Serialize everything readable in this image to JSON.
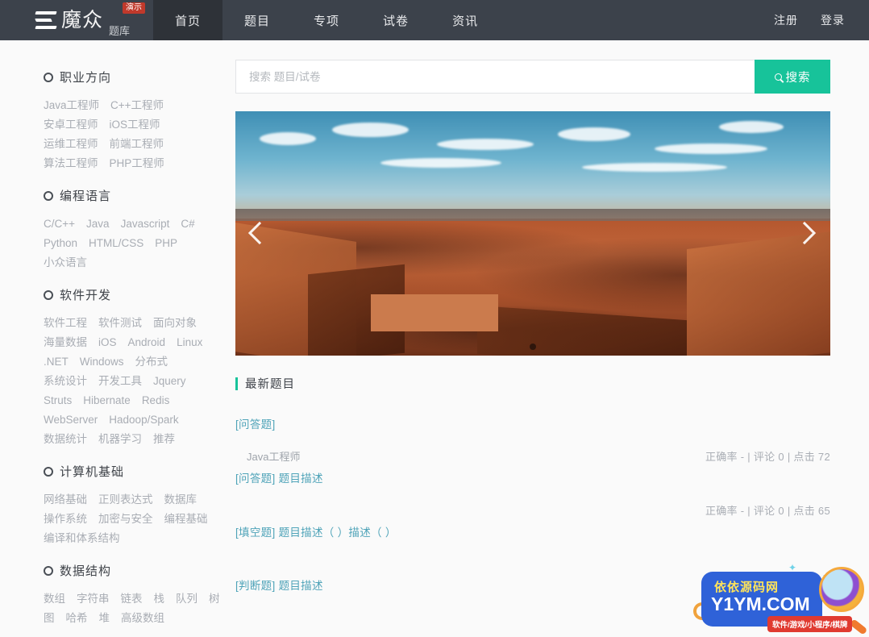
{
  "header": {
    "brand_name": "魔众",
    "brand_sub": "题库",
    "brand_badge": "演示",
    "nav": [
      {
        "label": "首页",
        "active": true
      },
      {
        "label": "题目",
        "active": false
      },
      {
        "label": "专项",
        "active": false
      },
      {
        "label": "试卷",
        "active": false
      },
      {
        "label": "资讯",
        "active": false
      }
    ],
    "register": "注册",
    "login": "登录"
  },
  "search": {
    "placeholder": "搜索 题目/试卷",
    "value": "",
    "button_label": "搜索",
    "button_color": "#17c39a"
  },
  "sidebar": {
    "categories": [
      {
        "title": "职业方向",
        "tags": [
          "Java工程师",
          "C++工程师",
          "安卓工程师",
          "iOS工程师",
          "运维工程师",
          "前端工程师",
          "算法工程师",
          "PHP工程师"
        ]
      },
      {
        "title": "编程语言",
        "tags": [
          "C/C++",
          "Java",
          "Javascript",
          "C#",
          "Python",
          "HTML/CSS",
          "PHP",
          "小众语言"
        ]
      },
      {
        "title": "软件开发",
        "tags": [
          "软件工程",
          "软件测试",
          "面向对象",
          "海量数据",
          "iOS",
          "Android",
          "Linux",
          ".NET",
          "Windows",
          "分布式",
          "系统设计",
          "开发工具",
          "Jquery",
          "Struts",
          "Hibernate",
          "Redis",
          "WebServer",
          "Hadoop/Spark",
          "数据统计",
          "机器学习",
          "推荐"
        ]
      },
      {
        "title": "计算机基础",
        "tags": [
          "网络基础",
          "正则表达式",
          "数据库",
          "操作系统",
          "加密与安全",
          "编程基础",
          "编译和体系结构"
        ]
      },
      {
        "title": "数据结构",
        "tags": [
          "数组",
          "字符串",
          "链表",
          "栈",
          "队列",
          "树",
          "图",
          "哈希",
          "堆",
          "高级数组"
        ]
      }
    ]
  },
  "carousel": {
    "prev_label": "上一张",
    "next_label": "下一张",
    "dots": 1,
    "active_dot": 0,
    "overlay_color": "#cb7b4d"
  },
  "section": {
    "title": "最新题目",
    "accent": "#17c39a"
  },
  "questions": [
    {
      "type": "[问答题]",
      "desc": "",
      "tag": "Java工程师",
      "stats": "正确率 - | 评论 0 | 点击 72"
    },
    {
      "type": "[问答题]",
      "desc": "题目描述",
      "tag": "",
      "stats": "正确率 - | 评论 0 | 点击 65"
    },
    {
      "type": "[填空题]",
      "desc": "题目描述（ ）描述（ ）",
      "tag": "",
      "stats": ""
    },
    {
      "type": "[判断题]",
      "desc": "题目描述",
      "tag": "",
      "stats": ""
    }
  ],
  "watermark": {
    "cn": "依依源码网",
    "domain": "Y1YM.COM",
    "ribbon": "软件/游戏/小程序/棋牌"
  }
}
